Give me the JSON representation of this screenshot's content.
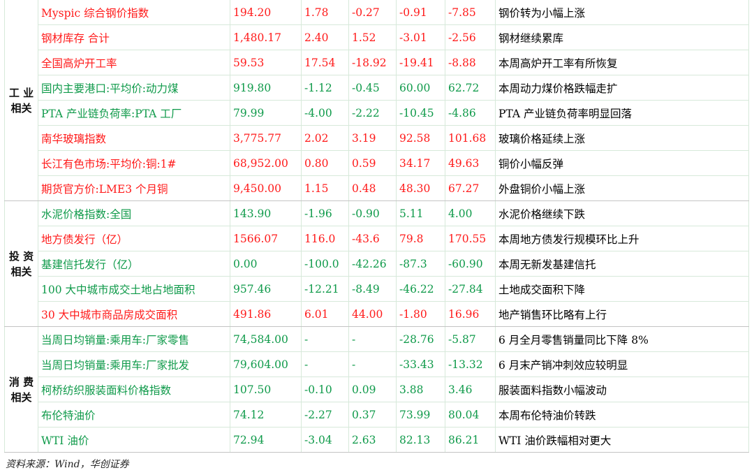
{
  "groups": [
    {
      "category": "工 业\n相关",
      "rows": [
        {
          "name": "Myspic 综合钢价指数",
          "v1": "194.20",
          "v2": "1.78",
          "v3": "-0.27",
          "v4": "-0.91",
          "v5": "-7.85",
          "comment": "钢价转为小幅上涨",
          "color": "red"
        },
        {
          "name": "钢材库存 合计",
          "v1": "1,480.17",
          "v2": "2.40",
          "v3": "1.52",
          "v4": "-3.01",
          "v5": "-2.56",
          "comment": "钢材继续累库",
          "color": "red"
        },
        {
          "name": "全国高炉开工率",
          "v1": "59.53",
          "v2": "17.54",
          "v3": "-18.92",
          "v4": "-19.41",
          "v5": "-8.88",
          "comment": "本周高炉开工率有所恢复",
          "color": "red"
        },
        {
          "name": "国内主要港口:平均价:动力煤",
          "v1": "919.80",
          "v2": "-1.12",
          "v3": "-0.45",
          "v4": "60.00",
          "v5": "62.72",
          "comment": "本周动力煤价格跌幅走扩",
          "color": "green"
        },
        {
          "name": "PTA 产业链负荷率:PTA 工厂",
          "v1": "79.99",
          "v2": "-4.00",
          "v3": "-2.22",
          "v4": "-10.45",
          "v5": "-4.86",
          "comment": "PTA 产业链负荷率明显回落",
          "color": "green"
        },
        {
          "name": "南华玻璃指数",
          "v1": "3,775.77",
          "v2": "2.02",
          "v3": "3.19",
          "v4": "92.58",
          "v5": "101.68",
          "comment": "玻璃价格延续上涨",
          "color": "red"
        },
        {
          "name": "长江有色市场:平均价:铜:1#",
          "v1": "68,952.00",
          "v2": "0.80",
          "v3": "0.59",
          "v4": "34.17",
          "v5": "49.63",
          "comment": "铜价小幅反弹",
          "color": "red"
        },
        {
          "name": "期货官方价:LME3 个月铜",
          "v1": "9,450.00",
          "v2": "1.15",
          "v3": "0.48",
          "v4": "48.30",
          "v5": "67.27",
          "comment": "外盘铜价小幅上涨",
          "color": "red"
        }
      ]
    },
    {
      "category": "投 资\n相关",
      "rows": [
        {
          "name": "水泥价格指数:全国",
          "v1": "143.90",
          "v2": "-1.96",
          "v3": "-0.90",
          "v4": "5.11",
          "v5": "4.00",
          "comment": "水泥价格继续下跌",
          "color": "green"
        },
        {
          "name": "地方债发行（亿）",
          "v1": "1566.07",
          "v2": "116.0",
          "v3": "-43.6",
          "v4": "79.8",
          "v5": "170.55",
          "comment": "本周地方债发行规模环比上升",
          "color": "red"
        },
        {
          "name": "基建信托发行（亿）",
          "v1": "0.00",
          "v2": "-100.0",
          "v3": "-42.26",
          "v4": "-87.3",
          "v5": "-60.90",
          "comment": "本周无新发基建信托",
          "color": "green"
        },
        {
          "name": "100 大中城市成交土地占地面积",
          "v1": "957.46",
          "v2": "-12.21",
          "v3": "-8.49",
          "v4": "-46.22",
          "v5": "-27.84",
          "comment": "土地成交面积下降",
          "color": "green"
        },
        {
          "name": "30 大中城市商品房成交面积",
          "v1": "491.86",
          "v2": "6.01",
          "v3": "44.00",
          "v4": "-1.80",
          "v5": "16.96",
          "comment": "地产销售环比略有上行",
          "color": "red"
        }
      ]
    },
    {
      "category": "消 费\n相关",
      "rows": [
        {
          "name": "当周日均销量:乘用车:厂家零售",
          "v1": "74,584.00",
          "v2": "-",
          "v3": "-",
          "v4": "-28.76",
          "v5": "-5.87",
          "comment": "6 月全月零售销量同比下降 8%",
          "color": "green"
        },
        {
          "name": "当周日均销量:乘用车:厂家批发",
          "v1": "79,604.00",
          "v2": "-",
          "v3": "-",
          "v4": "-33.43",
          "v5": "-13.32",
          "comment": "6 月末产销冲刺效应较明显",
          "color": "green"
        },
        {
          "name": "柯桥纺织服装面料价格指数",
          "v1": "107.50",
          "v2": "-0.10",
          "v3": "0.09",
          "v4": "3.88",
          "v5": "3.46",
          "comment": "服装面料指数小幅波动",
          "color": "green"
        },
        {
          "name": "布伦特油价",
          "v1": "74.12",
          "v2": "-2.27",
          "v3": "0.37",
          "v4": "73.99",
          "v5": "80.04",
          "comment": "本周布伦特油价转跌",
          "color": "green"
        },
        {
          "name": "WTI 油价",
          "v1": "72.94",
          "v2": "-3.04",
          "v3": "2.63",
          "v4": "82.13",
          "v5": "86.21",
          "comment": "WTI 油价跌幅相对更大",
          "color": "green"
        }
      ]
    }
  ],
  "source": "资料来源：Wind，华创证券",
  "colors": {
    "up": "#ff1a1a",
    "down": "#0f9a4a",
    "grid": "#d7e9da"
  }
}
